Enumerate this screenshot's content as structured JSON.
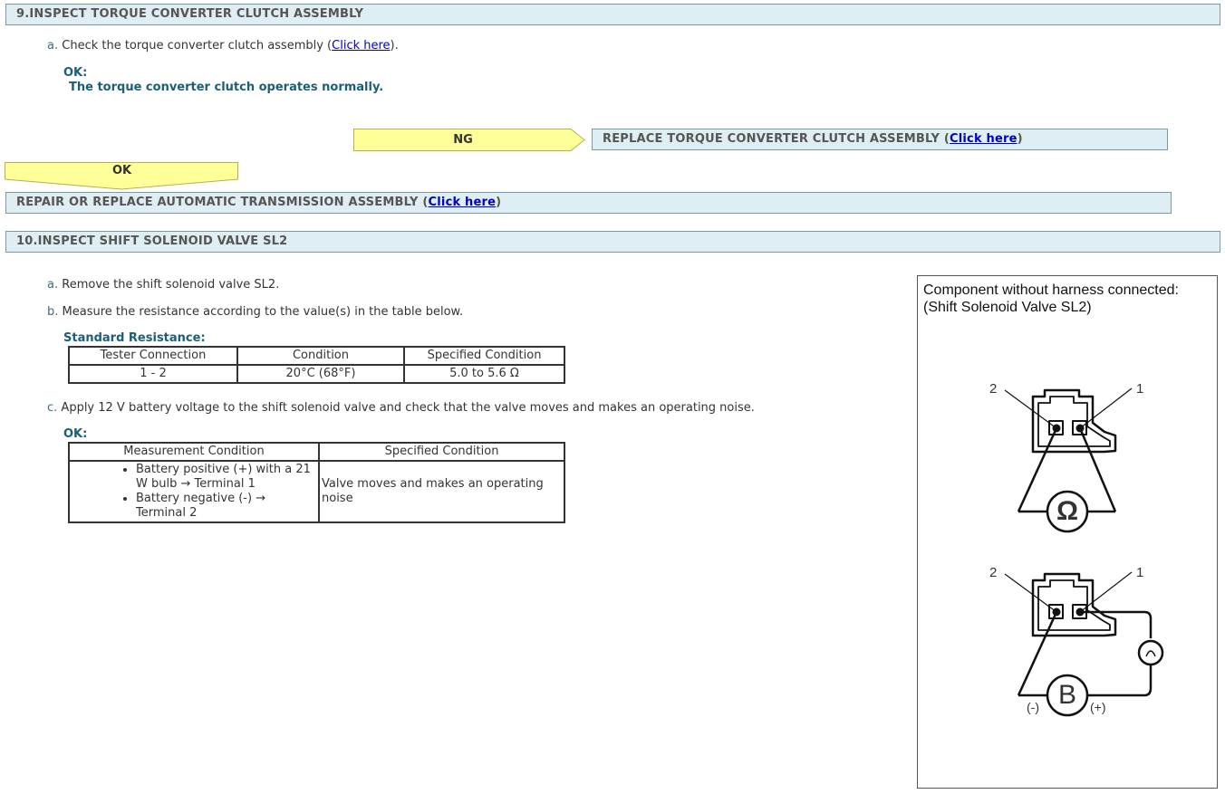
{
  "section9": {
    "title": "9.INSPECT TORQUE CONVERTER CLUTCH ASSEMBLY",
    "step_a_letter": "a.",
    "step_a_text": "Check the torque converter clutch assembly (",
    "step_a_link": "Click here",
    "step_a_tail": ").",
    "ok_label": "OK:",
    "ok_text": "The torque converter clutch operates normally.",
    "ng_arrow": "NG",
    "ng_action_text": "REPLACE TORQUE CONVERTER CLUTCH ASSEMBLY (",
    "ng_action_link": "Click here",
    "ng_action_tail": ")",
    "ok_arrow": "OK",
    "ok_action_text": "REPAIR OR REPLACE AUTOMATIC TRANSMISSION ASSEMBLY (",
    "ok_action_link": "Click here",
    "ok_action_tail": ")"
  },
  "section10": {
    "title": "10.INSPECT SHIFT SOLENOID VALVE SL2",
    "step_a_letter": "a.",
    "step_a_text": "Remove the shift solenoid valve SL2.",
    "step_b_letter": "b.",
    "step_b_text": "Measure the resistance according to the value(s) in the table below.",
    "std_label": "Standard Resistance:",
    "resistance_table": {
      "headers": [
        "Tester Connection",
        "Condition",
        "Specified Condition"
      ],
      "row": [
        "1 - 2",
        "20°C (68°F)",
        "5.0 to 5.6 Ω"
      ]
    },
    "step_c_letter": "c.",
    "step_c_text": "Apply 12 V battery voltage to the shift solenoid valve and check that the valve moves and makes an operating noise.",
    "ok_label": "OK:",
    "operation_table": {
      "headers": [
        "Measurement Condition",
        "Specified Condition"
      ],
      "conditions": [
        "Battery positive (+) with a 21 W bulb → Terminal 1",
        "Battery negative (-) → Terminal 2"
      ],
      "result": "Valve moves and makes an operating noise"
    }
  },
  "figure": {
    "caption_line1": "Component without harness connected:",
    "caption_line2": "(Shift Solenoid Valve SL2)",
    "terminal_2": "2",
    "terminal_1": "1",
    "ohm_symbol": "Ω",
    "battery_symbol": "B",
    "minus_label": "(-)",
    "plus_label": "(+)"
  },
  "colors": {
    "bar_bg": "#dfeef2",
    "arrow_yellow": "#ffff99",
    "link": "#0000cc",
    "ok_text": "#1a5e78"
  }
}
